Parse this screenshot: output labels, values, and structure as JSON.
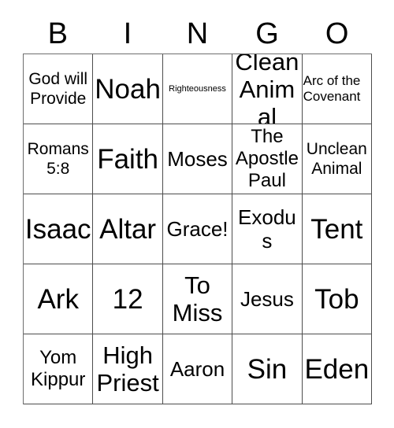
{
  "card": {
    "title_letters": [
      "B",
      "I",
      "N",
      "G",
      "O"
    ],
    "rows": [
      [
        {
          "text": "God will Provide",
          "size": "fs-m"
        },
        {
          "text": "Noah",
          "size": "fs-xxl"
        },
        {
          "text": "Righteousness",
          "size": "fs-xs"
        },
        {
          "text": "Clean Animal",
          "size": "fs-xl"
        },
        {
          "text": "Arc of the Covenant",
          "size": "fs-s"
        }
      ],
      [
        {
          "text": "Romans 5:8",
          "size": "fs-m"
        },
        {
          "text": "Faith",
          "size": "fs-xxl"
        },
        {
          "text": "Moses",
          "size": "fs-l"
        },
        {
          "text": "The Apostle Paul",
          "size": "fs-ml"
        },
        {
          "text": "Unclean Animal",
          "size": "fs-m"
        }
      ],
      [
        {
          "text": "Isaac",
          "size": "fs-xxl"
        },
        {
          "text": "Altar",
          "size": "fs-xxl"
        },
        {
          "text": "Grace!",
          "size": "fs-l"
        },
        {
          "text": "Exodus",
          "size": "fs-l"
        },
        {
          "text": "Tent",
          "size": "fs-xxl"
        }
      ],
      [
        {
          "text": "Ark",
          "size": "fs-xxl"
        },
        {
          "text": "12",
          "size": "fs-xxl"
        },
        {
          "text": "To Miss",
          "size": "fs-xl"
        },
        {
          "text": "Jesus",
          "size": "fs-l"
        },
        {
          "text": "Tob",
          "size": "fs-xxl"
        }
      ],
      [
        {
          "text": "Yom Kippur",
          "size": "fs-ml"
        },
        {
          "text": "High Priest",
          "size": "fs-xl"
        },
        {
          "text": "Aaron",
          "size": "fs-l"
        },
        {
          "text": "Sin",
          "size": "fs-xxl"
        },
        {
          "text": "Eden",
          "size": "fs-xxl"
        }
      ]
    ]
  },
  "colors": {
    "background": "#ffffff",
    "text": "#000000",
    "grid_line": "#4d4d4d"
  }
}
